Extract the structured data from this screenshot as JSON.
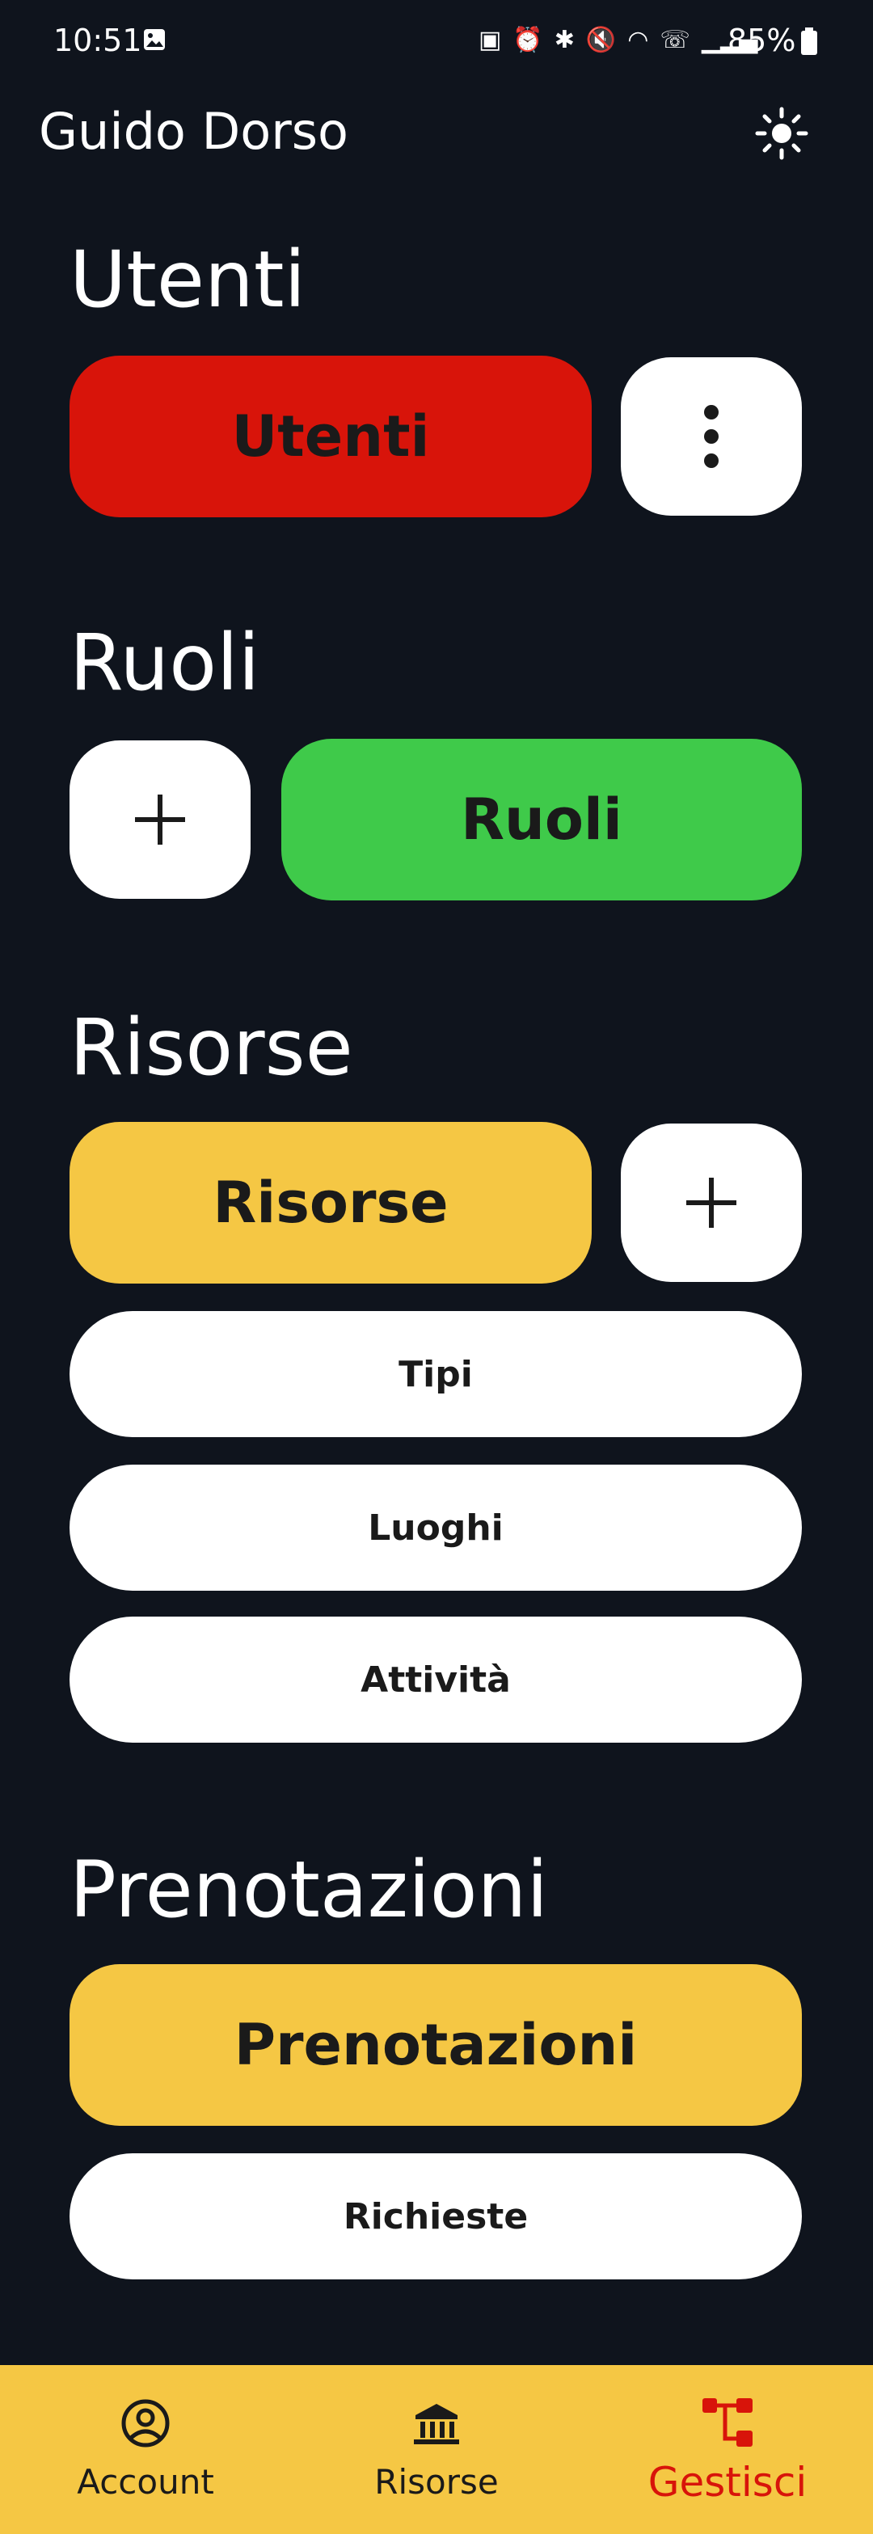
{
  "status_bar": {
    "time": "10:51",
    "battery": "85%"
  },
  "app_bar": {
    "title": "Guido Dorso"
  },
  "sections": {
    "utenti": {
      "title": "Utenti",
      "main_button": "Utenti"
    },
    "ruoli": {
      "title": "Ruoli",
      "main_button": "Ruoli"
    },
    "risorse": {
      "title": "Risorse",
      "main_button": "Risorse",
      "sub_buttons": [
        "Tipi",
        "Luoghi",
        "Attività"
      ]
    },
    "prenotazioni": {
      "title": "Prenotazioni",
      "main_button": "Prenotazioni",
      "sub_buttons": [
        "Richieste"
      ]
    }
  },
  "bottom_nav": {
    "items": [
      {
        "label": "Account",
        "icon": "account-circle-icon"
      },
      {
        "label": "Risorse",
        "icon": "bank-icon"
      },
      {
        "label": "Gestisci",
        "icon": "hierarchy-icon",
        "active": true
      }
    ]
  },
  "colors": {
    "background": "#0f141d",
    "red": "#d8140a",
    "green": "#3fca4a",
    "yellow": "#f5c744",
    "active_nav": "#d8140a"
  }
}
